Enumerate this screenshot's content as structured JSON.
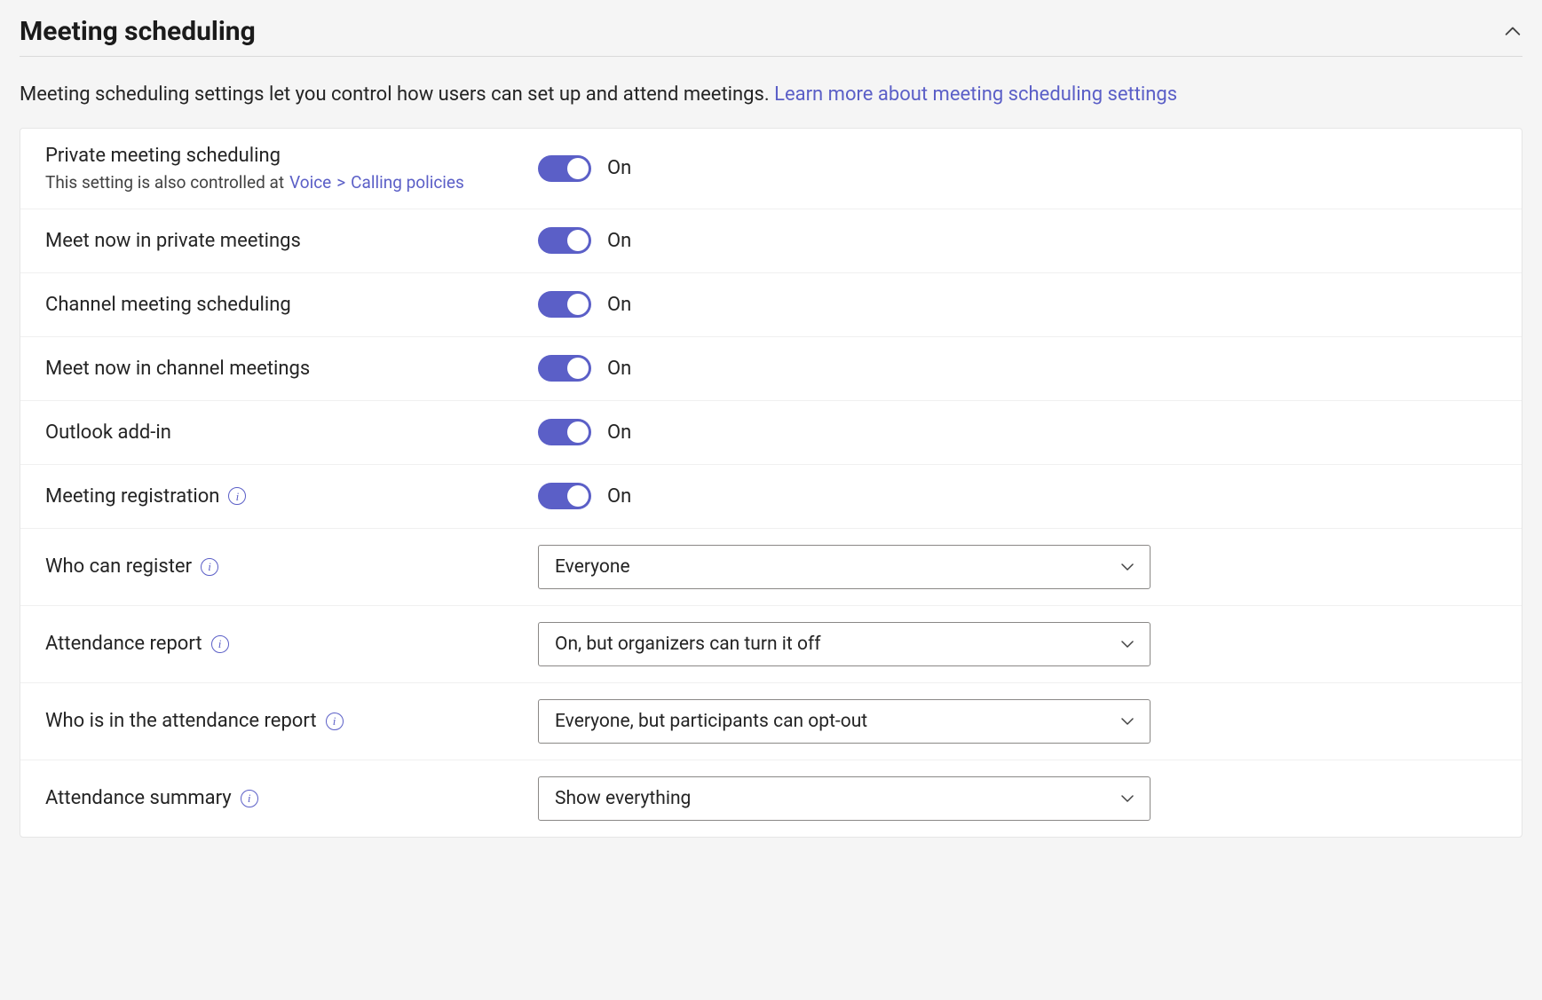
{
  "section": {
    "title": "Meeting scheduling",
    "description": "Meeting scheduling settings let you control how users can set up and attend meetings.",
    "learn_more": "Learn more about meeting scheduling settings"
  },
  "rows": {
    "private_meeting_scheduling": {
      "label": "Private meeting scheduling",
      "sub_pre": "This setting is also controlled at",
      "sub_link1": "Voice",
      "sub_sep": ">",
      "sub_link2": "Calling policies",
      "state": "On"
    },
    "meet_now_private": {
      "label": "Meet now in private meetings",
      "state": "On"
    },
    "channel_meeting_scheduling": {
      "label": "Channel meeting scheduling",
      "state": "On"
    },
    "meet_now_channel": {
      "label": "Meet now in channel meetings",
      "state": "On"
    },
    "outlook_addin": {
      "label": "Outlook add-in",
      "state": "On"
    },
    "meeting_registration": {
      "label": "Meeting registration",
      "state": "On"
    },
    "who_can_register": {
      "label": "Who can register",
      "value": "Everyone"
    },
    "attendance_report": {
      "label": "Attendance report",
      "value": "On, but organizers can turn it off"
    },
    "who_in_report": {
      "label": "Who is in the attendance report",
      "value": "Everyone, but participants can opt-out"
    },
    "attendance_summary": {
      "label": "Attendance summary",
      "value": "Show everything"
    }
  }
}
